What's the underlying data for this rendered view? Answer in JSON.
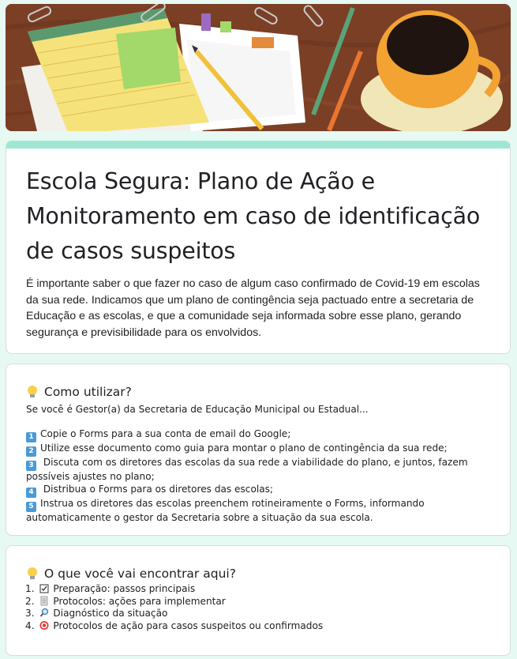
{
  "header": {
    "title": "Escola Segura: Plano de Ação e Monitoramento em caso de identificação de casos suspeitos",
    "description": "É importante saber o que fazer no caso de algum caso confirmado de Covid-19 em escolas da sua rede. Indicamos que um plano de contingência seja pactuado entre a secretaria de Educação e as escolas, e que a comunidade seja informada sobre esse plano, gerando segurança e previsibilidade para os envolvidos."
  },
  "how_to": {
    "icon": "lightbulb-icon",
    "title": "Como utilizar?",
    "intro": "Se você é Gestor(a) da Secretaria de Educação Municipal ou Estadual...",
    "steps": [
      {
        "num": "1",
        "text": "Copie o Forms para a sua conta de email do Google;"
      },
      {
        "num": "2",
        "text": "Utilize esse documento como guia para montar o plano de contingência da sua rede;"
      },
      {
        "num": "3",
        "text": " Discuta com os diretores das escolas da sua rede a viabilidade do plano, e juntos, fazem possíveis ajustes no plano;"
      },
      {
        "num": "4",
        "text": " Distribua o Forms para os diretores das escolas;"
      },
      {
        "num": "5",
        "text": "Instrua os diretores das escolas preenchem rotineiramente o Forms, informando automaticamente o gestor da Secretaria sobre a situação da sua escola."
      }
    ]
  },
  "contents": {
    "icon": "lightbulb-icon",
    "title": "O que você vai encontrar aqui?",
    "items": [
      {
        "num": "1.",
        "icon": "checkbox-icon",
        "text": "Preparação: passos principais"
      },
      {
        "num": "2.",
        "icon": "notepad-icon",
        "text": "Protocolos: ações para implementar"
      },
      {
        "num": "3.",
        "icon": "magnifier-icon",
        "text": "Diagnóstico da situação"
      },
      {
        "num": "4.",
        "icon": "target-icon",
        "text": "Protocolos de ação para casos suspeitos ou confirmados"
      }
    ]
  },
  "colors": {
    "page_background": "#e6f9f3",
    "accent": "#9fe7d3",
    "keycap": "#4a9ad8"
  }
}
